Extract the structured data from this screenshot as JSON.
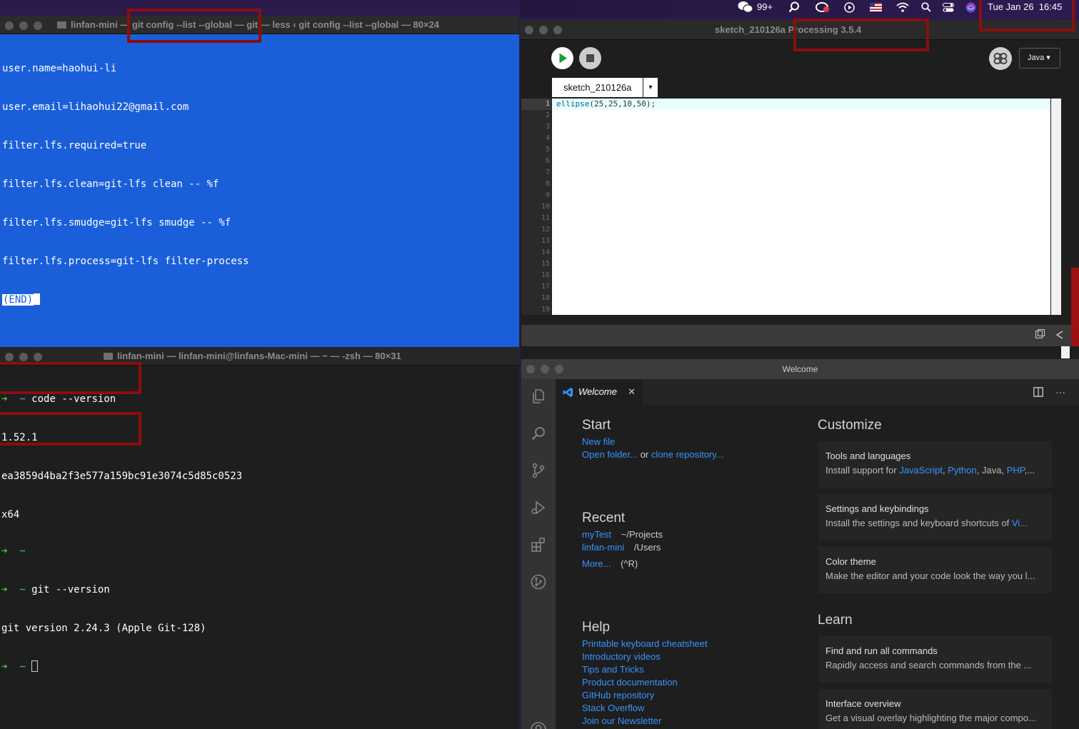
{
  "menubar": {
    "wechat_badge": "99+",
    "datetime": "Tue Jan 26  16:45"
  },
  "terminal1": {
    "title": "linfan-mini — git config --list --global — git — less ‹ git config --list --global — 80×24",
    "lines": [
      "user.name=haohui-li",
      "user.email=lihaohui22@gmail.com",
      "filter.lfs.required=true",
      "filter.lfs.clean=git-lfs clean -- %f",
      "filter.lfs.smudge=git-lfs smudge -- %f",
      "filter.lfs.process=git-lfs filter-process"
    ],
    "end_marker": "(END)"
  },
  "terminal2": {
    "title": "linfan-mini — linfan-mini@linfans-Mac-mini — ~ — -zsh — 80×31",
    "prompt_arrow": "➜",
    "prompt_dir": "~",
    "cmd1": "code --version",
    "out1": "1.52.1",
    "out2": "ea3859d4ba2f3e577a159bc91e3074c5d85c0523",
    "out3": "x64",
    "cmd2": "git --version",
    "out4": "git version 2.24.3 (Apple Git-128)"
  },
  "processing": {
    "title_sketch": "sketch_210126a",
    "title_app": "Processing 3.5.4",
    "mode": "Java ▾",
    "tab": "sketch_210126a",
    "tab_menu": "▾",
    "code_fn": "ellipse",
    "code_args": "(25,25,10,50);",
    "line_numbers": [
      "1",
      "2",
      "3",
      "4",
      "5",
      "6",
      "7",
      "8",
      "9",
      "10",
      "11",
      "12",
      "13",
      "14",
      "15",
      "16",
      "17",
      "18",
      "19"
    ]
  },
  "vscode": {
    "window_title": "Welcome",
    "tab_label": "Welcome",
    "start": {
      "heading": "Start",
      "new_file": "New file",
      "open_folder": "Open folder...",
      "or": "or",
      "clone": "clone repository..."
    },
    "recent": {
      "heading": "Recent",
      "items": [
        {
          "name": "myTest",
          "path": "~/Projects"
        },
        {
          "name": "linfan-mini",
          "path": "/Users"
        }
      ],
      "more": "More...",
      "more_shortcut": "(^R)"
    },
    "help": {
      "heading": "Help",
      "links": [
        "Printable keyboard cheatsheet",
        "Introductory videos",
        "Tips and Tricks",
        "Product documentation",
        "GitHub repository",
        "Stack Overflow",
        "Join our Newsletter"
      ]
    },
    "customize": {
      "heading": "Customize",
      "tools_title": "Tools and languages",
      "tools_prefix": "Install support for ",
      "tools_js": "JavaScript",
      "tools_py": "Python",
      "tools_java": "Java,",
      "tools_php": "PHP",
      "tools_suffix": ",...",
      "settings_title": "Settings and keybindings",
      "settings_prefix": "Install the settings and keyboard shortcuts of ",
      "settings_link": "Vi...",
      "theme_title": "Color theme",
      "theme_desc": "Make the editor and your code look the way you l..."
    },
    "learn": {
      "heading": "Learn",
      "find_title": "Find and run all commands",
      "find_desc": "Rapidly access and search commands from the ...",
      "overview_title": "Interface overview",
      "overview_desc": "Get a visual overlay highlighting the major compo..."
    }
  },
  "colors": {
    "terminal1_bg": "#1a5fd9",
    "annotation_red": "#8b0e0e",
    "vscode_link": "#3794ff"
  }
}
